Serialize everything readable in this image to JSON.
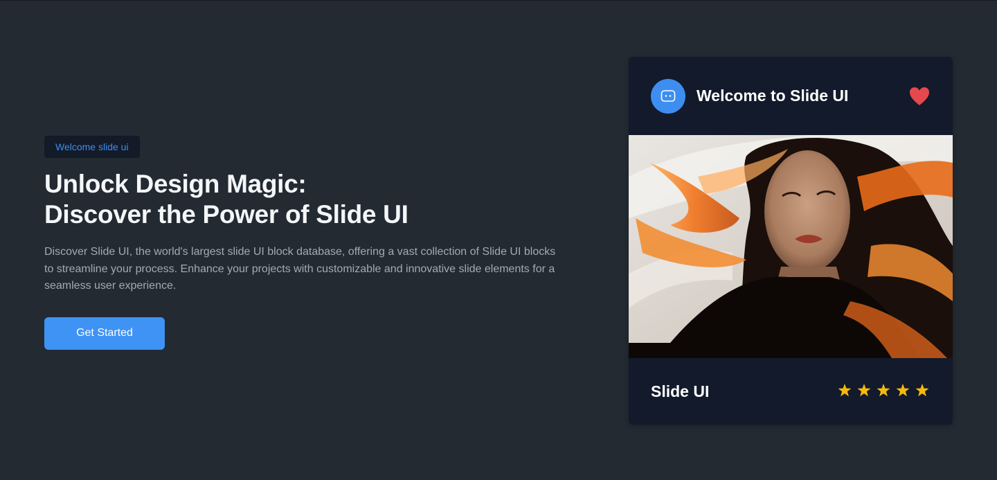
{
  "hero": {
    "badge": "Welcome slide ui",
    "title_line1": "Unlock Design Magic:",
    "title_line2": "Discover the Power of Slide UI",
    "description": "Discover Slide UI, the world's largest slide UI block database, offering a vast collection of Slide UI blocks to streamline your process. Enhance your projects with customizable and innovative slide elements for a seamless user experience.",
    "cta_label": "Get Started"
  },
  "card": {
    "title": "Welcome to Slide UI",
    "avatar_icon": "chat-bubble-icon",
    "favorite_icon": "heart-icon",
    "image_subject": "woman with flowing orange and dark hair",
    "name": "Slide UI",
    "rating": 5,
    "rating_max": 5
  },
  "colors": {
    "background": "#232a32",
    "card": "#121a2b",
    "accent": "#3e93f4",
    "heart": "#e5484d",
    "star": "#f5b90f"
  }
}
